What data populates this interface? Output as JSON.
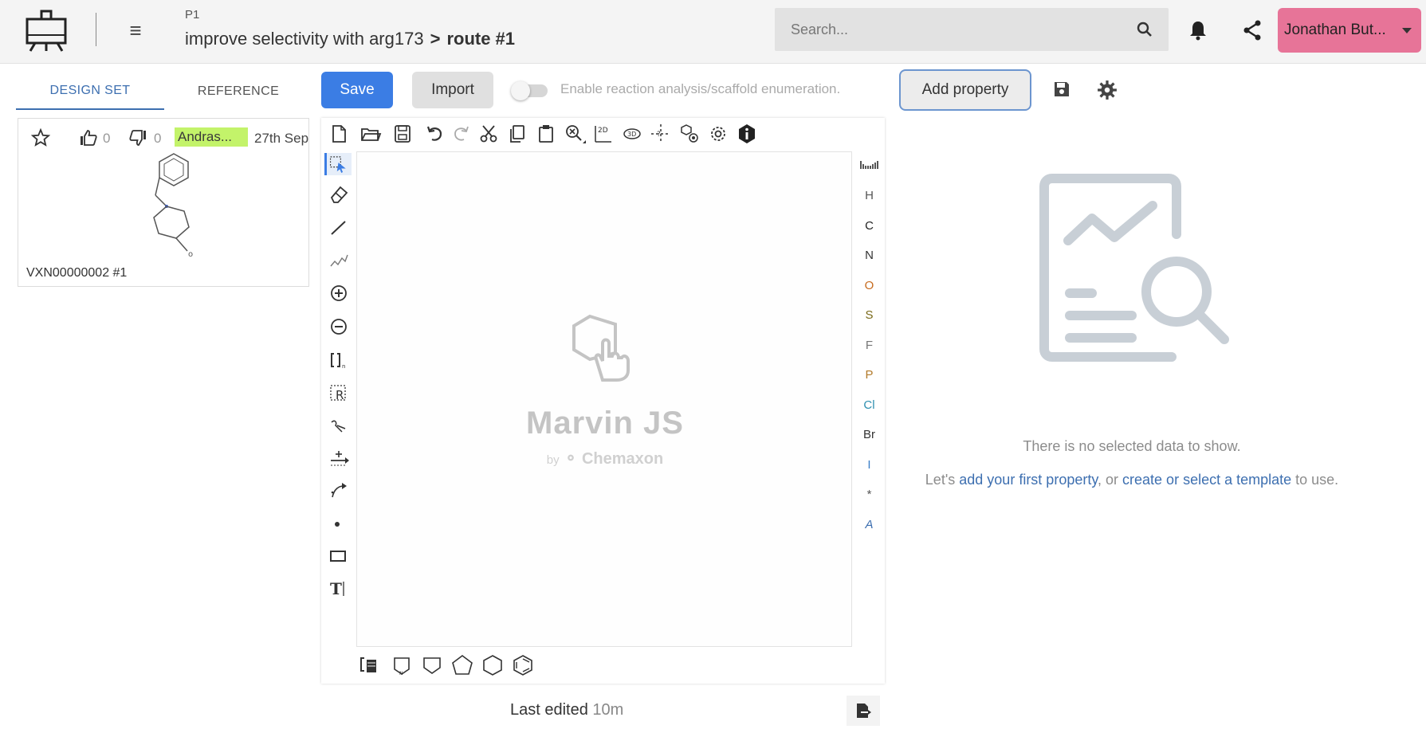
{
  "header": {
    "project_code": "P1",
    "project_title": "improve selectivity with arg173",
    "separator": ">",
    "route": "route #1",
    "search_placeholder": "Search...",
    "user_name": "Jonathan But..."
  },
  "tabs": {
    "design_set": "DESIGN SET",
    "reference": "REFERENCE"
  },
  "card": {
    "likes": "0",
    "dislikes": "0",
    "author": "Andras...",
    "date": "27th Sep",
    "compound_id": "VXN00000002 #1"
  },
  "toolbar": {
    "save_label": "Save",
    "import_label": "Import",
    "toggle_label": "Enable reaction analysis/scaffold enumeration.",
    "toggle_on": false,
    "add_property_label": "Add property"
  },
  "editor": {
    "watermark_title": "Marvin JS",
    "watermark_by": "by",
    "watermark_vendor": "Chemaxon",
    "atoms": [
      "H",
      "C",
      "N",
      "O",
      "S",
      "F",
      "P",
      "Cl",
      "Br",
      "I",
      "*",
      "A"
    ],
    "atom_colors": [
      "#555555",
      "#222222",
      "#333333",
      "#c76b1e",
      "#7a6a1a",
      "#777777",
      "#b27a2a",
      "#2e8fb0",
      "#333333",
      "#3a7fc8",
      "#555555",
      "#3d6fb0"
    ]
  },
  "footer": {
    "last_edited_label": "Last edited",
    "last_edited_value": "10m"
  },
  "empty_state": {
    "message": "There is no selected data to show.",
    "hint_prefix": "Let's ",
    "hint_link1": "add your first property",
    "hint_middle": ", or ",
    "hint_link2": "create or select a template",
    "hint_suffix": " to use."
  },
  "colors": {
    "accent": "#3b7de4",
    "user_button": "#e77498",
    "author_tag": "#c3f36a",
    "link": "#3d6fb0"
  }
}
